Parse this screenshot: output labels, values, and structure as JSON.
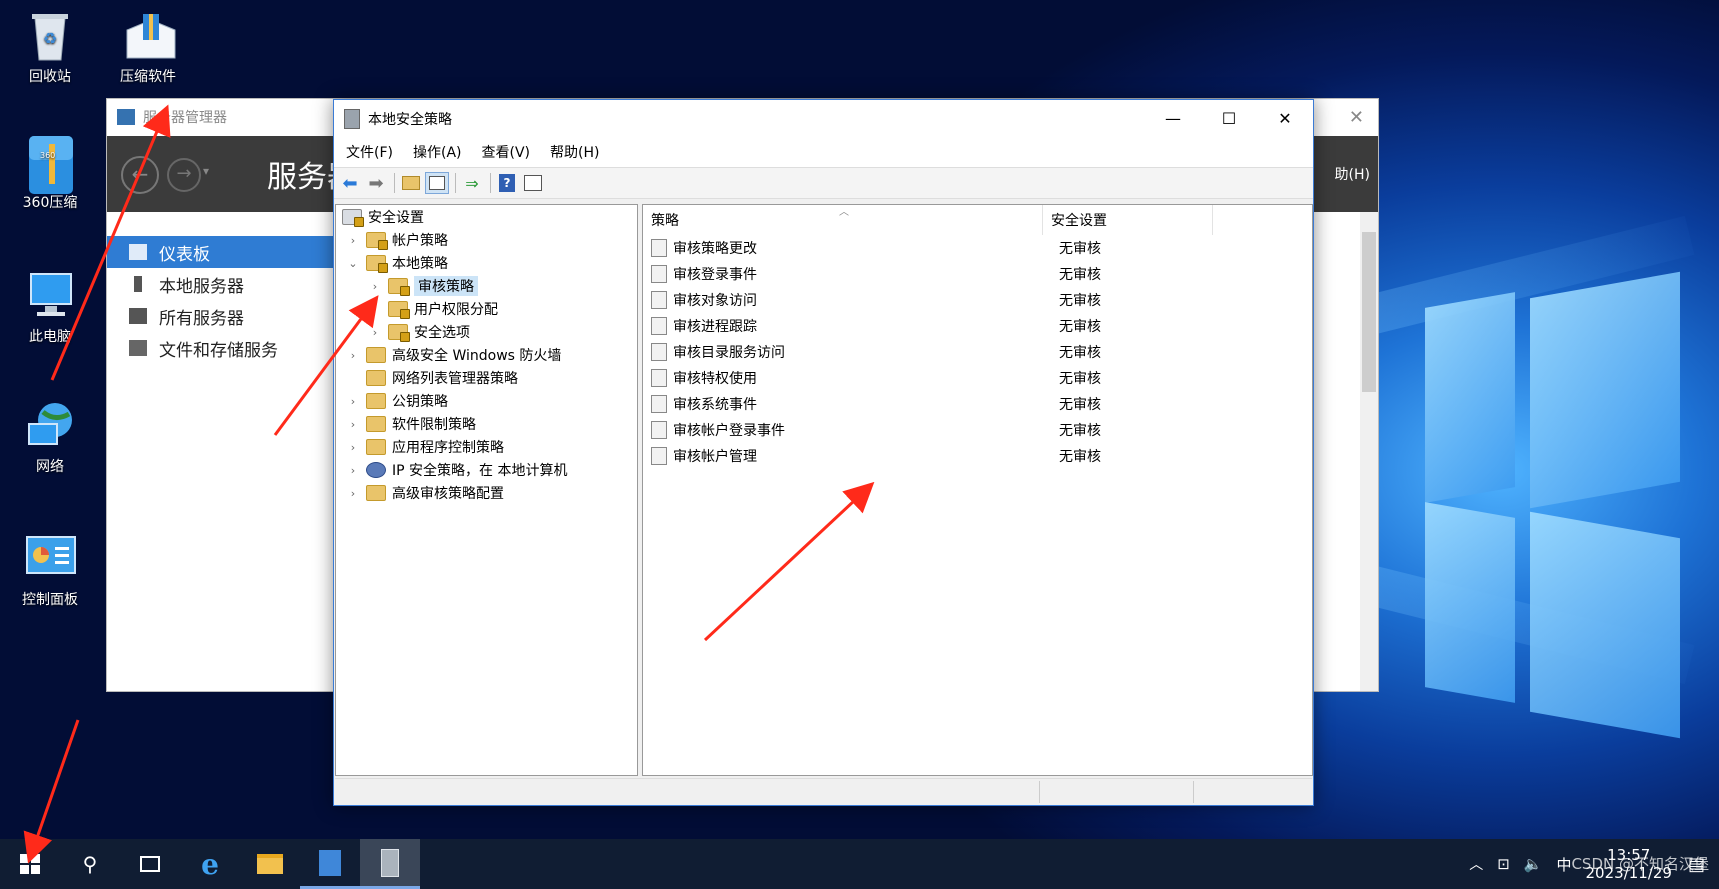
{
  "desktop": {
    "icons": [
      {
        "label": "回收站",
        "icon": "recycle-bin-icon"
      },
      {
        "label": "压缩软件",
        "sub": "360压",
        "icon": "archive-box-icon"
      },
      {
        "label": "360压缩",
        "icon": "zip-archive-icon"
      },
      {
        "label": "此电脑",
        "icon": "computer-icon"
      },
      {
        "label": "网络",
        "icon": "network-globe-icon"
      },
      {
        "label": "控制面板",
        "icon": "control-panel-icon"
      }
    ]
  },
  "server_manager": {
    "title": "服务器管理器",
    "header_title": "服务器",
    "help_menu": "助(H)",
    "nav": [
      {
        "label": "仪表板",
        "icon": "dashboard-icon",
        "selected": true
      },
      {
        "label": "本地服务器",
        "icon": "server-icon"
      },
      {
        "label": "所有服务器",
        "icon": "servers-icon"
      },
      {
        "label": "文件和存储服务",
        "icon": "storage-icon"
      }
    ]
  },
  "lsp_window": {
    "title": "本地安全策略",
    "menu": [
      "文件(F)",
      "操作(A)",
      "查看(V)",
      "帮助(H)"
    ],
    "tree": [
      {
        "label": "安全设置",
        "level": 0,
        "chevron": "",
        "icon": "security-settings-icon"
      },
      {
        "label": "帐户策略",
        "level": 1,
        "chevron": "›",
        "icon": "folder-lock-icon"
      },
      {
        "label": "本地策略",
        "level": 1,
        "chevron": "⌄",
        "icon": "folder-lock-icon"
      },
      {
        "label": "审核策略",
        "level": 2,
        "chevron": "›",
        "icon": "folder-lock-icon",
        "selected": true
      },
      {
        "label": "用户权限分配",
        "level": 2,
        "chevron": "",
        "icon": "folder-lock-icon"
      },
      {
        "label": "安全选项",
        "level": 2,
        "chevron": "›",
        "icon": "folder-lock-icon"
      },
      {
        "label": "高级安全 Windows 防火墙",
        "level": 1,
        "chevron": "›",
        "icon": "folder-icon"
      },
      {
        "label": "网络列表管理器策略",
        "level": 1,
        "chevron": "",
        "icon": "folder-icon"
      },
      {
        "label": "公钥策略",
        "level": 1,
        "chevron": "›",
        "icon": "folder-icon"
      },
      {
        "label": "软件限制策略",
        "level": 1,
        "chevron": "›",
        "icon": "folder-icon"
      },
      {
        "label": "应用程序控制策略",
        "level": 1,
        "chevron": "›",
        "icon": "folder-icon"
      },
      {
        "label": "IP 安全策略，在 本地计算机",
        "level": 1,
        "chevron": "›",
        "icon": "ip-security-icon"
      },
      {
        "label": "高级审核策略配置",
        "level": 1,
        "chevron": "›",
        "icon": "folder-icon"
      }
    ],
    "columns": {
      "policy": "策略",
      "setting": "安全设置"
    },
    "rows": [
      {
        "policy": "审核策略更改",
        "setting": "无审核"
      },
      {
        "policy": "审核登录事件",
        "setting": "无审核"
      },
      {
        "policy": "审核对象访问",
        "setting": "无审核"
      },
      {
        "policy": "审核进程跟踪",
        "setting": "无审核"
      },
      {
        "policy": "审核目录服务访问",
        "setting": "无审核"
      },
      {
        "policy": "审核特权使用",
        "setting": "无审核"
      },
      {
        "policy": "审核系统事件",
        "setting": "无审核"
      },
      {
        "policy": "审核帐户登录事件",
        "setting": "无审核"
      },
      {
        "policy": "审核帐户管理",
        "setting": "无审核"
      }
    ]
  },
  "taskbar": {
    "items": [
      "start-icon",
      "search-icon",
      "task-view-icon",
      "internet-explorer-icon",
      "file-explorer-icon",
      "server-manager-icon",
      "local-security-policy-icon"
    ],
    "ime": "中",
    "time": "13:57",
    "date": "2023/11/29",
    "watermark": "CSDN @不知名汉堡"
  },
  "colors": {
    "arrow": "#ff2a1a",
    "selection": "#2f7cd3",
    "taskbar": "#101d33"
  }
}
